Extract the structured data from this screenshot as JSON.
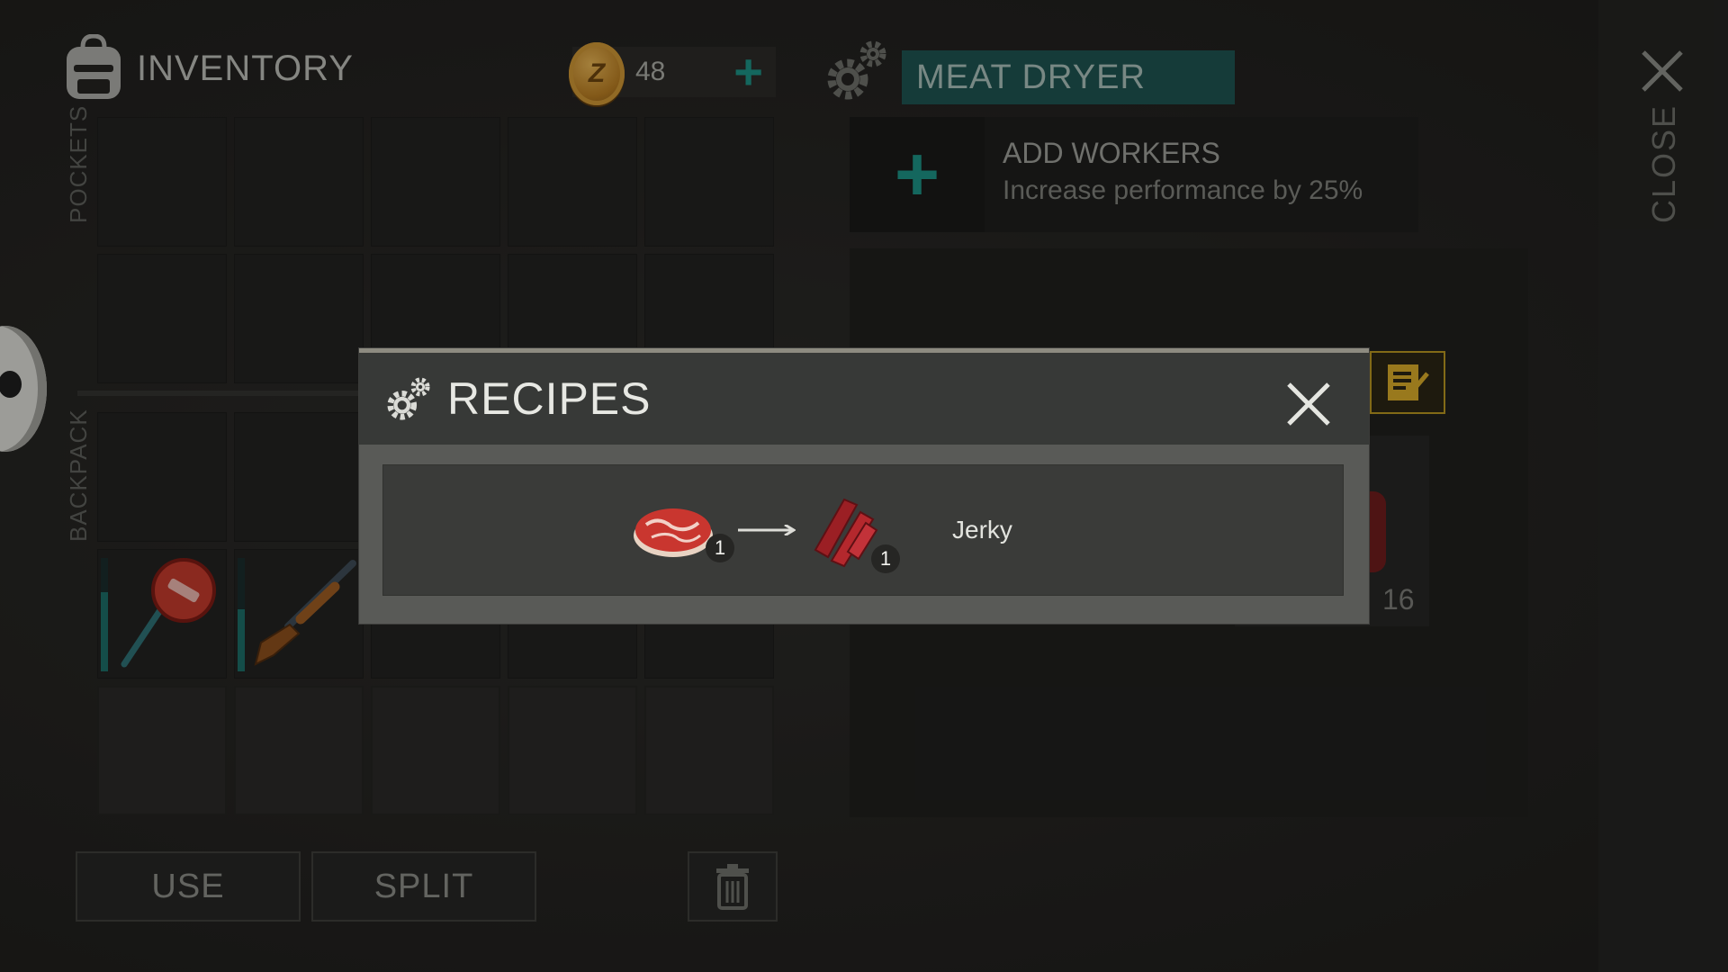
{
  "inventory": {
    "title": "INVENTORY",
    "coins": "48",
    "coin_symbol": "Z",
    "pockets_label": "POCKETS",
    "backpack_label": "BACKPACK",
    "use_label": "USE",
    "split_label": "SPLIT",
    "items": [
      {
        "name": "stop-sign-icon",
        "durability": 0.7
      },
      {
        "name": "shotgun-icon",
        "durability": 0.55
      }
    ]
  },
  "dryer": {
    "title": "MEAT DRYER",
    "workers_title": "ADD WORKERS",
    "workers_desc": "Increase performance by 25%",
    "slot_count": "16",
    "close_label": "CLOSE"
  },
  "recipes_modal": {
    "title": "RECIPES",
    "recipes": [
      {
        "input_icon": "raw-meat-icon",
        "input_qty": "1",
        "output_icon": "jerky-icon",
        "output_qty": "1",
        "name": "Jerky"
      }
    ]
  },
  "colors": {
    "accent_teal": "#1c8f83",
    "title_bar": "#1e5350",
    "note_gold": "#b59320"
  }
}
